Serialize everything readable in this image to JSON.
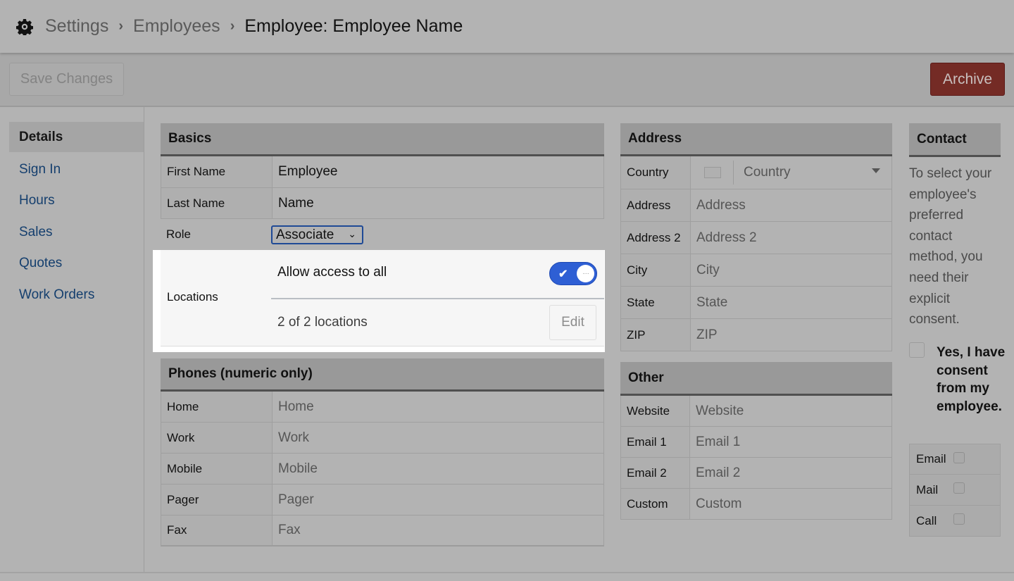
{
  "header": {
    "icon": "gear-icon",
    "breadcrumbs": [
      "Settings",
      "Employees",
      "Employee: Employee Name"
    ],
    "separator": "›"
  },
  "toolbar": {
    "save_label": "Save Changes",
    "archive_label": "Archive",
    "archive_color": "#742b25"
  },
  "sidebar": {
    "items": [
      {
        "label": "Details",
        "active": true
      },
      {
        "label": "Sign In"
      },
      {
        "label": "Hours"
      },
      {
        "label": "Sales"
      },
      {
        "label": "Quotes"
      },
      {
        "label": "Work Orders"
      }
    ]
  },
  "basics": {
    "title": "Basics",
    "first_name_label": "First Name",
    "first_name_value": "Employee",
    "last_name_label": "Last Name",
    "last_name_value": "Name",
    "role_label": "Role",
    "role_value": "Associate",
    "locations": {
      "label": "Locations",
      "allow_all_label": "Allow access to all",
      "allow_all_on": true,
      "count_text": "2 of 2 locations",
      "edit_label": "Edit",
      "toggle_color": "#2e5fd4"
    }
  },
  "phones": {
    "title": "Phones (numeric only)",
    "rows": [
      {
        "label": "Home",
        "placeholder": "Home"
      },
      {
        "label": "Work",
        "placeholder": "Work"
      },
      {
        "label": "Mobile",
        "placeholder": "Mobile"
      },
      {
        "label": "Pager",
        "placeholder": "Pager"
      },
      {
        "label": "Fax",
        "placeholder": "Fax"
      }
    ]
  },
  "address": {
    "title": "Address",
    "country_label": "Country",
    "country_placeholder": "Country",
    "rows": [
      {
        "label": "Address",
        "placeholder": "Address"
      },
      {
        "label": "Address 2",
        "placeholder": "Address 2"
      },
      {
        "label": "City",
        "placeholder": "City"
      },
      {
        "label": "State",
        "placeholder": "State"
      },
      {
        "label": "ZIP",
        "placeholder": "ZIP"
      }
    ]
  },
  "other": {
    "title": "Other",
    "rows": [
      {
        "label": "Website",
        "placeholder": "Website"
      },
      {
        "label": "Email 1",
        "placeholder": "Email 1"
      },
      {
        "label": "Email 2",
        "placeholder": "Email 2"
      },
      {
        "label": "Custom",
        "placeholder": "Custom"
      }
    ]
  },
  "contact": {
    "title": "Contact",
    "description": "To select your employee's preferred contact method, you need their explicit consent.",
    "consent_label": "Yes, I have consent from my employee.",
    "consent_checked": false,
    "methods": [
      {
        "label": "Email",
        "checked": false
      },
      {
        "label": "Mail",
        "checked": false
      },
      {
        "label": "Call",
        "checked": false
      }
    ]
  }
}
